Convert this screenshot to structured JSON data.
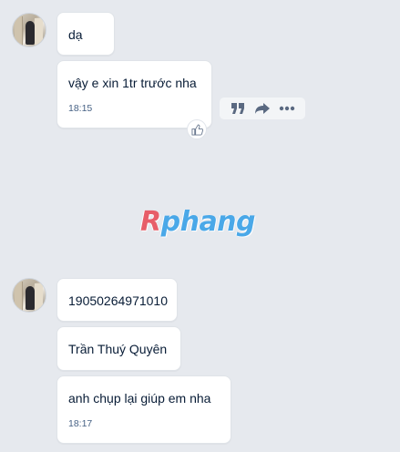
{
  "watermark": {
    "first_letter": "R",
    "rest": "phang"
  },
  "messages_group_1": {
    "items": [
      {
        "text": "dạ"
      },
      {
        "text": "vậy e xin 1tr trước nha",
        "time": "18:15"
      }
    ],
    "actions": [
      "quote-icon",
      "forward-icon",
      "more-icon"
    ],
    "like_icon": "thumbs-up-icon"
  },
  "messages_group_2": {
    "items": [
      {
        "text": "19050264971010"
      },
      {
        "text": "Trần Thuý Quyên"
      },
      {
        "text": "anh chụp lại giúp em nha",
        "time": "18:17"
      }
    ]
  },
  "colors": {
    "background": "#e6e9ee",
    "bubble": "#ffffff",
    "time_text": "#476285",
    "icon": "#5a6981",
    "watermark_red": "#e8505b",
    "watermark_blue": "#3aa2e8"
  }
}
